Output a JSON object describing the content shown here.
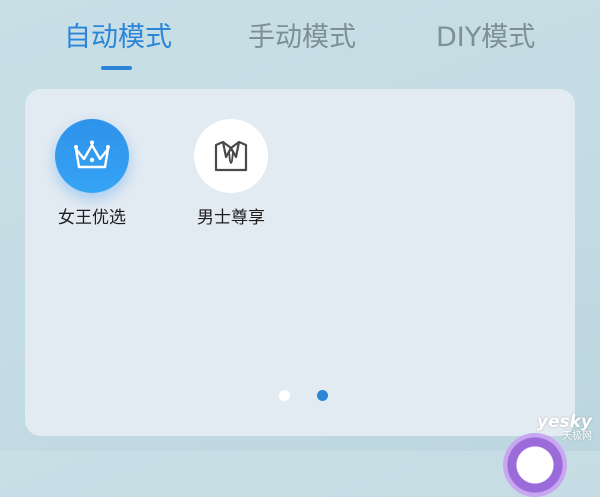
{
  "tabs": [
    {
      "label": "自动模式",
      "active": true
    },
    {
      "label": "手动模式",
      "active": false
    },
    {
      "label": "DIY模式",
      "active": false
    }
  ],
  "modes": [
    {
      "label": "女王优选",
      "icon": "crown-icon",
      "selected": true
    },
    {
      "label": "男士尊享",
      "icon": "suit-tie-icon",
      "selected": false
    }
  ],
  "pagination": {
    "pages": 2,
    "current": 2
  },
  "watermark": {
    "latin": "yesky",
    "cn": "天极网"
  },
  "colors": {
    "accent": "#2b86d9",
    "inactive_tab": "#7d8f97",
    "panel": "#e3ebf2",
    "background": "#c9dfe6"
  }
}
